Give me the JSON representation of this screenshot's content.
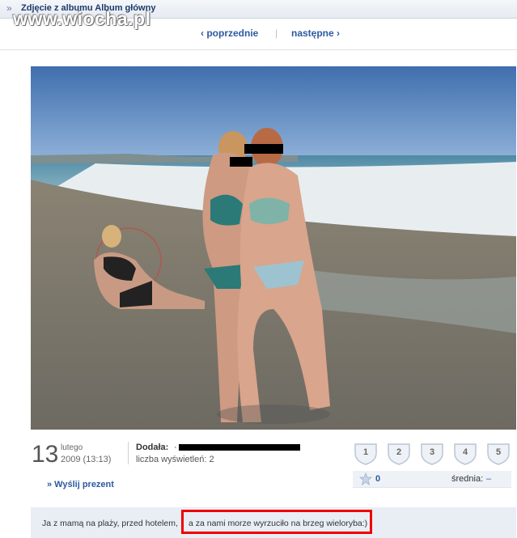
{
  "header": {
    "breadcrumb_arrow": "»",
    "album_title": "Zdjęcie z albumu Album główny",
    "watermark": "www.wiocha.pl"
  },
  "nav": {
    "prev": "‹ poprzednie",
    "separator": "|",
    "next": "następne ›"
  },
  "photo": {
    "scene": "beach"
  },
  "meta": {
    "day": "13",
    "month": "lutego",
    "year_time": "2009 (13:13)",
    "added_label": "Dodała:",
    "added_name": "·",
    "views_label": "liczba wyświetleń:",
    "views_value": "2"
  },
  "rating": {
    "options": [
      "1",
      "2",
      "3",
      "4",
      "5"
    ],
    "votes": "0",
    "average_label": "średnia:",
    "average_value": "–"
  },
  "gift": {
    "label": "» Wyślij prezent"
  },
  "description": {
    "part1": "Ja z mamą na plaży, przed hotelem,",
    "part2": "a za nami morze wyrzuciło na brzeg wieloryba:)"
  },
  "colors": {
    "link": "#2c5aa0",
    "highlight": "#ee0000",
    "description_bg": "#e9eef5"
  }
}
